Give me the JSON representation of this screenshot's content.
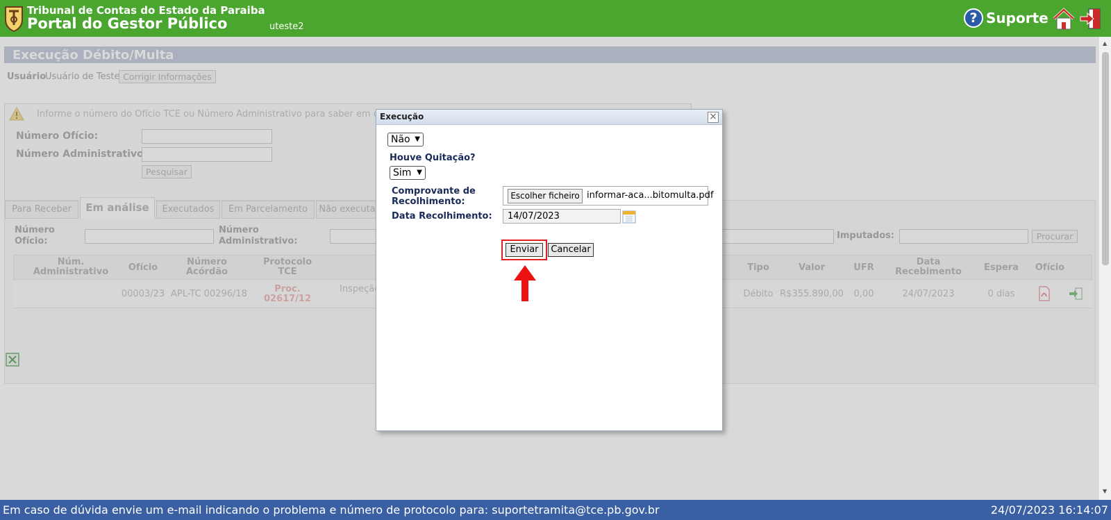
{
  "header": {
    "org_name": "Tribunal de Contas do Estado da Paraiba",
    "portal_name": "Portal do Gestor Público",
    "username": "uteste2",
    "support_label": "Suporte",
    "help_glyph": "?",
    "brand_color": "#4aa62f"
  },
  "page": {
    "title": "Execução Débito/Multa",
    "user_label": "Usuário",
    "user_value": "Usuário de Teste",
    "fix_info_button": "Corrigir Informações",
    "info_message": "Informe o número do Ofício TCE ou Número Administrativo para saber em que s",
    "numero_oficio_label": "Número Ofício:",
    "numero_administrativo_label": "Número Administrativo:",
    "search_button": "Pesquisar"
  },
  "tabs": [
    {
      "label": "Para Receber",
      "active": false
    },
    {
      "label": "Em análise",
      "active": true
    },
    {
      "label": "Executados",
      "active": false
    },
    {
      "label": "Em Parcelamento",
      "active": false
    },
    {
      "label": "Não executa",
      "active": false
    }
  ],
  "filters": {
    "numero_oficio_label": "Número Ofício:",
    "numero_administrativo_label": "Número Administrativo:",
    "imputados_label": "Imputados:",
    "procurar_button": "Procurar"
  },
  "table": {
    "columns": {
      "num_administrativo": "Núm. Administrativo",
      "oficio": "Ofício",
      "numero_acordao": "Número Acórdão",
      "protocolo_tce": "Protocolo TCE",
      "tipo": "Tipo",
      "valor": "Valor",
      "ufr": "UFR",
      "data_recebimento": "Data Recebimento",
      "espera": "Espera",
      "oficio_doc": "Ofício"
    },
    "rows": [
      {
        "num_administrativo": "",
        "oficio": "00003/23",
        "numero_acordao": "APL-TC 00296/18",
        "protocolo_line1": "Proc.",
        "protocolo_line2": "02617/12",
        "descricao": "Inspeção",
        "tipo": "Débito",
        "valor": "R$355.890,00",
        "ufr": "0,00",
        "data_recebimento": "24/07/2023",
        "espera": "0 dias"
      }
    ]
  },
  "modal": {
    "title": "Execução",
    "close_glyph": "×",
    "first_select_value": "Não",
    "quitacao_label": "Houve Quitação?",
    "quitacao_value": "Sim",
    "comprovante_label_line1": "Comprovante de",
    "comprovante_label_line2": "Recolhimento:",
    "file_button": "Escolher ficheiro",
    "file_name": "informar-aca...bitomulta.pdf",
    "data_label": "Data Recolhimento:",
    "data_value": "14/07/2023",
    "enviar_button": "Enviar",
    "cancelar_button": "Cancelar",
    "highlight_color": "#e02020"
  },
  "footer": {
    "message": "Em caso de dúvida envie um e-mail indicando o problema e número de protocolo para: suportetramita@tce.pb.gov.br",
    "datetime": "24/07/2023 16:14:07",
    "color": "#3a5fa3"
  },
  "icons": [
    "shield-logo-icon",
    "help-icon",
    "home-icon",
    "exit-icon",
    "warning-icon",
    "pdf-icon",
    "enter-icon",
    "excel-icon",
    "calendar-icon",
    "close-icon",
    "chevron-down-icon",
    "red-arrow-up-icon"
  ]
}
